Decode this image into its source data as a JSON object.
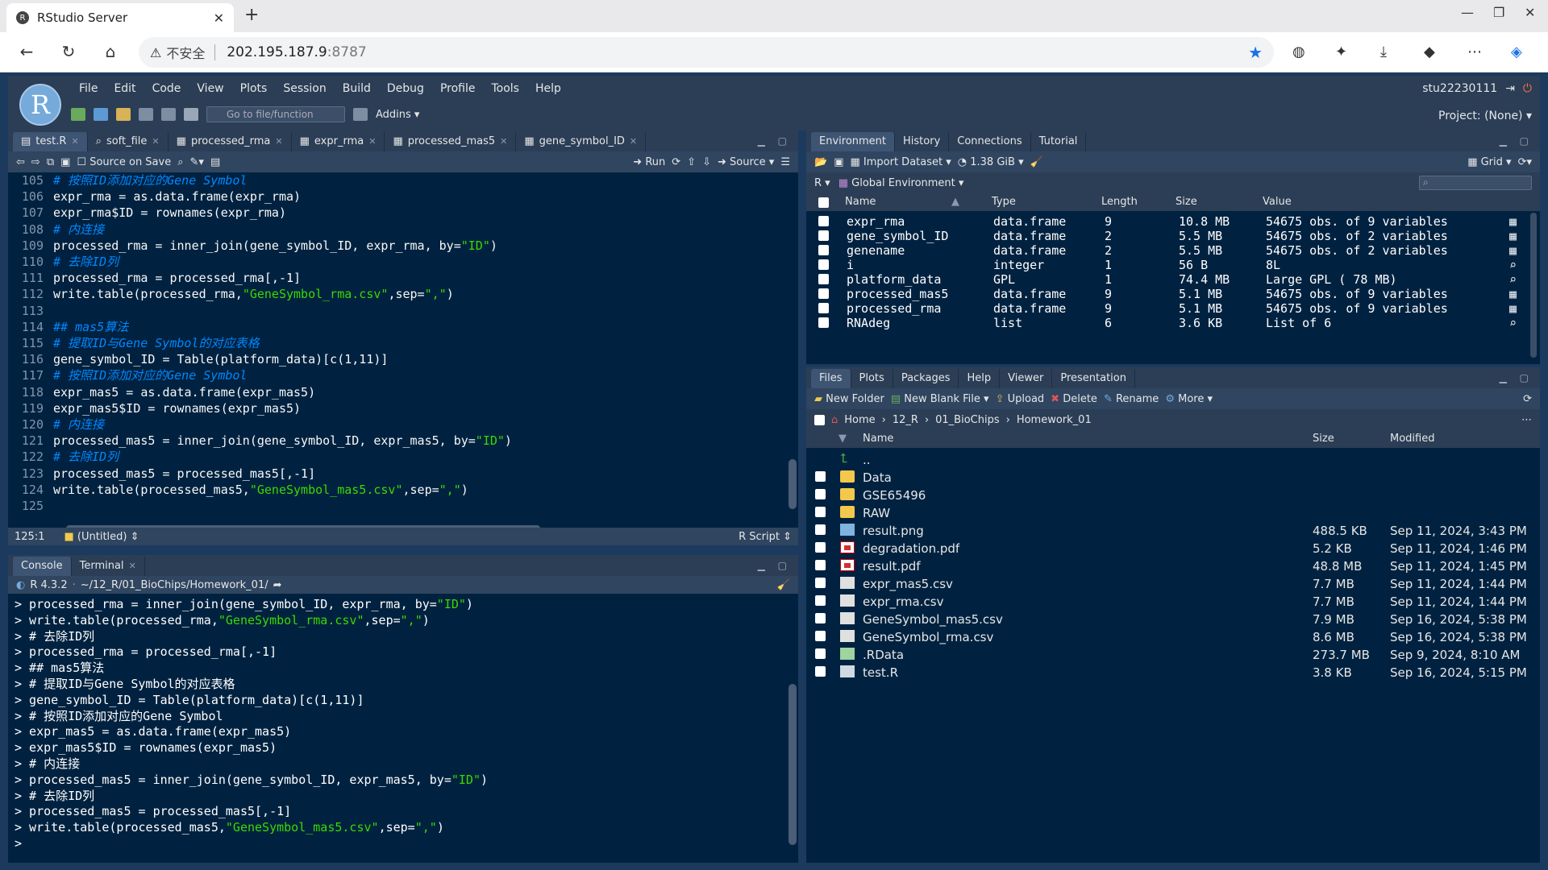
{
  "browser": {
    "tab_title": "RStudio Server",
    "tab_favicon": "R",
    "new_tab": "+",
    "insecure_label": "不安全",
    "url_host": "202.195.187.9",
    "url_port": ":8787"
  },
  "rstudio": {
    "logo": "R",
    "menu": [
      "File",
      "Edit",
      "Code",
      "View",
      "Plots",
      "Session",
      "Build",
      "Debug",
      "Profile",
      "Tools",
      "Help"
    ],
    "goto_placeholder": "Go to file/function",
    "addins": "Addins",
    "user": "stu22230111",
    "project": "Project: (None)"
  },
  "editor": {
    "tabs": [
      "test.R",
      "soft_file",
      "processed_rma",
      "expr_rma",
      "processed_mas5",
      "gene_symbol_ID"
    ],
    "source_on_save": "Source on Save",
    "run": "Run",
    "source": "Source",
    "lines": [
      {
        "n": "105",
        "t": "# 按照ID添加对应的Gene Symbol",
        "c": "comment"
      },
      {
        "n": "106",
        "t": "expr_rma = as.data.frame(expr_rma)",
        "c": ""
      },
      {
        "n": "107",
        "t": "expr_rma$ID = rownames(expr_rma)",
        "c": ""
      },
      {
        "n": "108",
        "t": "# 内连接",
        "c": "comment"
      },
      {
        "n": "109",
        "t": "processed_rma = inner_join(gene_symbol_ID, expr_rma, by=\"ID\")",
        "c": ""
      },
      {
        "n": "110",
        "t": "# 去除ID列",
        "c": "comment"
      },
      {
        "n": "111",
        "t": "processed_rma = processed_rma[,-1]",
        "c": ""
      },
      {
        "n": "112",
        "t": "write.table(processed_rma,\"GeneSymbol_rma.csv\",sep=\",\")",
        "c": ""
      },
      {
        "n": "113",
        "t": "",
        "c": ""
      },
      {
        "n": "114",
        "t": "## mas5算法",
        "c": "comment"
      },
      {
        "n": "115",
        "t": "# 提取ID与Gene Symbol的对应表格",
        "c": "comment"
      },
      {
        "n": "116",
        "t": "gene_symbol_ID = Table(platform_data)[c(1,11)]",
        "c": ""
      },
      {
        "n": "117",
        "t": "# 按照ID添加对应的Gene Symbol",
        "c": "comment"
      },
      {
        "n": "118",
        "t": "expr_mas5 = as.data.frame(expr_mas5)",
        "c": ""
      },
      {
        "n": "119",
        "t": "expr_mas5$ID = rownames(expr_mas5)",
        "c": ""
      },
      {
        "n": "120",
        "t": "# 内连接",
        "c": "comment"
      },
      {
        "n": "121",
        "t": "processed_mas5 = inner_join(gene_symbol_ID, expr_mas5, by=\"ID\")",
        "c": ""
      },
      {
        "n": "122",
        "t": "# 去除ID列",
        "c": "comment"
      },
      {
        "n": "123",
        "t": "processed_mas5 = processed_mas5[,-1]",
        "c": ""
      },
      {
        "n": "124",
        "t": "write.table(processed_mas5,\"GeneSymbol_mas5.csv\",sep=\",\")",
        "c": ""
      },
      {
        "n": "125",
        "t": "",
        "c": ""
      }
    ],
    "cursor": "125:1",
    "scope": "(Untitled)",
    "filetype": "R Script"
  },
  "console": {
    "tabs": [
      "Console",
      "Terminal"
    ],
    "r_version": "R 4.3.2",
    "path": "~/12_R/01_BioChips/Homework_01/",
    "lines": [
      "> processed_rma = inner_join(gene_symbol_ID, expr_rma, by=\"ID\")",
      "> write.table(processed_rma,\"GeneSymbol_rma.csv\",sep=\",\")",
      "> # 去除ID列",
      "> processed_rma = processed_rma[,-1]",
      "> ## mas5算法",
      "> # 提取ID与Gene Symbol的对应表格",
      "> gene_symbol_ID = Table(platform_data)[c(1,11)]",
      "> # 按照ID添加对应的Gene Symbol",
      "> expr_mas5 = as.data.frame(expr_mas5)",
      "> expr_mas5$ID = rownames(expr_mas5)",
      "> # 内连接",
      "> processed_mas5 = inner_join(gene_symbol_ID, expr_mas5, by=\"ID\")",
      "> # 去除ID列",
      "> processed_mas5 = processed_mas5[,-1]",
      "> write.table(processed_mas5,\"GeneSymbol_mas5.csv\",sep=\",\")",
      "> "
    ]
  },
  "environment": {
    "tabs": [
      "Environment",
      "History",
      "Connections",
      "Tutorial"
    ],
    "import_dataset": "Import Dataset",
    "memory": "1.38 GiB",
    "view_mode": "Grid",
    "lang": "R",
    "scope": "Global Environment",
    "columns": [
      "Name",
      "Type",
      "Length",
      "Size",
      "Value"
    ],
    "rows": [
      {
        "name": "expr_rma",
        "type": "data.frame",
        "length": "9",
        "size": "10.8 MB",
        "value": "54675 obs. of 9 variables"
      },
      {
        "name": "gene_symbol_ID",
        "type": "data.frame",
        "length": "2",
        "size": "5.5 MB",
        "value": "54675 obs. of 2 variables"
      },
      {
        "name": "genename",
        "type": "data.frame",
        "length": "2",
        "size": "5.5 MB",
        "value": "54675 obs. of 2 variables"
      },
      {
        "name": "i",
        "type": "integer",
        "length": "1",
        "size": "56 B",
        "value": "8L"
      },
      {
        "name": "platform_data",
        "type": "GPL",
        "length": "1",
        "size": "74.4 MB",
        "value": "Large GPL ( 78 MB)"
      },
      {
        "name": "processed_mas5",
        "type": "data.frame",
        "length": "9",
        "size": "5.1 MB",
        "value": "54675 obs. of 9 variables"
      },
      {
        "name": "processed_rma",
        "type": "data.frame",
        "length": "9",
        "size": "5.1 MB",
        "value": "54675 obs. of 9 variables"
      },
      {
        "name": "RNAdeg",
        "type": "list",
        "length": "6",
        "size": "3.6 KB",
        "value": "List of 6"
      }
    ]
  },
  "files": {
    "tabs": [
      "Files",
      "Plots",
      "Packages",
      "Help",
      "Viewer",
      "Presentation"
    ],
    "new_folder": "New Folder",
    "new_blank_file": "New Blank File",
    "upload": "Upload",
    "delete": "Delete",
    "rename": "Rename",
    "more": "More",
    "breadcrumb": [
      "Home",
      "12_R",
      "01_BioChips",
      "Homework_01"
    ],
    "columns": [
      "Name",
      "Size",
      "Modified"
    ],
    "rows": [
      {
        "icon": "up",
        "name": "..",
        "size": "",
        "modified": ""
      },
      {
        "icon": "folder",
        "name": "Data",
        "size": "",
        "modified": ""
      },
      {
        "icon": "folder",
        "name": "GSE65496",
        "size": "",
        "modified": ""
      },
      {
        "icon": "folder",
        "name": "RAW",
        "size": "",
        "modified": ""
      },
      {
        "icon": "png",
        "name": "result.png",
        "size": "488.5 KB",
        "modified": "Sep 11, 2024, 3:43 PM"
      },
      {
        "icon": "pdf",
        "name": "degradation.pdf",
        "size": "5.2 KB",
        "modified": "Sep 11, 2024, 1:46 PM"
      },
      {
        "icon": "pdf",
        "name": "result.pdf",
        "size": "48.8 MB",
        "modified": "Sep 11, 2024, 1:45 PM"
      },
      {
        "icon": "csv",
        "name": "expr_mas5.csv",
        "size": "7.7 MB",
        "modified": "Sep 11, 2024, 1:44 PM"
      },
      {
        "icon": "csv",
        "name": "expr_rma.csv",
        "size": "7.7 MB",
        "modified": "Sep 11, 2024, 1:44 PM"
      },
      {
        "icon": "csv",
        "name": "GeneSymbol_mas5.csv",
        "size": "7.9 MB",
        "modified": "Sep 16, 2024, 5:38 PM"
      },
      {
        "icon": "csv",
        "name": "GeneSymbol_rma.csv",
        "size": "8.6 MB",
        "modified": "Sep 16, 2024, 5:38 PM"
      },
      {
        "icon": "rdata",
        "name": ".RData",
        "size": "273.7 MB",
        "modified": "Sep 9, 2024, 8:10 AM"
      },
      {
        "icon": "rfile",
        "name": "test.R",
        "size": "3.8 KB",
        "modified": "Sep 16, 2024, 5:15 PM"
      }
    ]
  }
}
